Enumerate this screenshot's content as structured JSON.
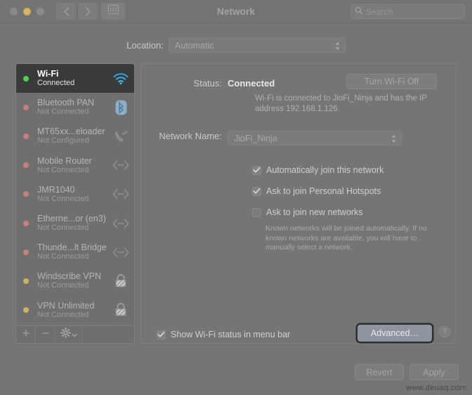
{
  "window": {
    "title": "Network",
    "traffic_lights": [
      "close-light",
      "minimize-light",
      "zoom-light"
    ],
    "nav_back_icon": "chevron-left-icon",
    "nav_forward_icon": "chevron-right-icon",
    "grid_icon": "all-preferences-grid-icon"
  },
  "search": {
    "placeholder": "Search",
    "icon": "search-icon"
  },
  "location": {
    "label": "Location:",
    "value": "Automatic",
    "options": [
      "Automatic"
    ]
  },
  "sidebar": {
    "items": [
      {
        "name": "Wi-Fi",
        "status": "Connected",
        "dot": "#4cd24c",
        "icon": "wifi-icon",
        "selected": true
      },
      {
        "name": "Bluetooth PAN",
        "status": "Not Connected",
        "dot": "#c97f7f",
        "icon": "bluetooth-icon",
        "selected": false
      },
      {
        "name": "MT65xx...eloader",
        "status": "Not Configured",
        "dot": "#c97f7f",
        "icon": "modem-phone-icon",
        "selected": false
      },
      {
        "name": "Mobile Router",
        "status": "Not Connected",
        "dot": "#c97f7f",
        "icon": "ethernet-icon",
        "selected": false
      },
      {
        "name": "JMR1040",
        "status": "Not Connected",
        "dot": "#c97f7f",
        "icon": "ethernet-icon",
        "selected": false
      },
      {
        "name": "Etherne...or (en3)",
        "status": "Not Connected",
        "dot": "#c97f7f",
        "icon": "ethernet-icon",
        "selected": false
      },
      {
        "name": "Thunde...lt Bridge",
        "status": "Not Connected",
        "dot": "#c97f7f",
        "icon": "ethernet-icon",
        "selected": false
      },
      {
        "name": "Windscribe VPN",
        "status": "Not Connected",
        "dot": "#cbb26a",
        "icon": "vpn-lock-icon",
        "selected": false
      },
      {
        "name": "VPN Unlimited",
        "status": "Not Connected",
        "dot": "#cbb26a",
        "icon": "vpn-lock-icon",
        "selected": false
      }
    ],
    "footer": {
      "add_icon": "plus-icon",
      "remove_icon": "minus-icon",
      "actions_icon": "gear-icon",
      "actions_chevron": "chevron-down-icon"
    }
  },
  "main": {
    "status_label": "Status:",
    "status_value": "Connected",
    "turn_off_button": "Turn Wi-Fi Off",
    "status_description": "Wi-Fi is connected to JioFi_Ninja and has the IP address 192.168.1.126.",
    "network_name_label": "Network Name:",
    "network_name_value": "JioFi_Ninja",
    "checkboxes": [
      {
        "label": "Automatically join this network",
        "checked": true
      },
      {
        "label": "Ask to join Personal Hotspots",
        "checked": true
      },
      {
        "label": "Ask to join new networks",
        "checked": false
      }
    ],
    "checkbox_note": "Known networks will be joined automatically. If no known networks are available, you will have to manually select a network.",
    "menu_bar_checkbox": {
      "label": "Show Wi-Fi status in menu bar",
      "checked": true
    },
    "advanced_button": "Advanced…",
    "help_button": "?"
  },
  "footer": {
    "revert_button": "Revert",
    "apply_button": "Apply",
    "watermark": "www.deuaq.com"
  },
  "colors": {
    "window_bg": "#757575",
    "selected_row": "#3a3a3a",
    "accent_blue": "#2f9fd8",
    "focus_ring": "#2e2e2e"
  }
}
